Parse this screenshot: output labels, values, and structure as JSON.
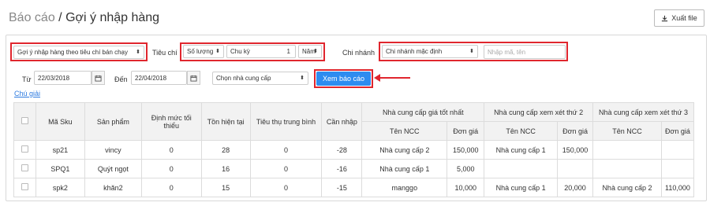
{
  "header": {
    "breadcrumb": "Báo cáo",
    "separator": " / ",
    "title": "Gợi ý nhập hàng",
    "export_label": "Xuất file"
  },
  "filters": {
    "mode_value": "Gợi ý nhập hàng theo tiêu chí bán chạy",
    "criteria_label": "Tiêu chí",
    "criteria_value": "Số lượng",
    "cycle_label": "Chu kỳ",
    "cycle_count": "1",
    "cycle_unit": "Năm",
    "branch_label": "Chi nhánh",
    "branch_value": "Chi nhánh mặc định",
    "search_placeholder": "Nhập mã, tên",
    "from_label": "Từ",
    "from_date": "22/03/2018",
    "to_label": "Đến",
    "to_date": "22/04/2018",
    "supplier_value": "Chọn nhà cung cấp",
    "report_button": "Xem báo cáo",
    "note_link": "Chú giải"
  },
  "table": {
    "headers": {
      "sku": "Mã Sku",
      "product": "Sản phẩm",
      "min_stock": "Định mức tối thiểu",
      "stock": "Tồn hiện tại",
      "avg_consumption": "Tiêu thụ trung bình",
      "need": "Cần nhập",
      "best_supplier": "Nhà cung cấp giá tốt nhất",
      "second_supplier": "Nhà cung cấp xem xét thứ 2",
      "third_supplier": "Nhà cung cấp xem xét thứ 3",
      "supplier_name": "Tên NCC",
      "unit_price": "Đơn giá"
    },
    "rows": [
      {
        "sku": "sp21",
        "product": "vincy",
        "min": "0",
        "stock": "28",
        "avg": "0",
        "need": "-28",
        "s1": "Nhà cung cấp 2",
        "p1": "150,000",
        "s2": "Nhà cung cấp 1",
        "p2": "150,000",
        "s3": "",
        "p3": ""
      },
      {
        "sku": "SPQ1",
        "product": "Quýt ngọt",
        "min": "0",
        "stock": "16",
        "avg": "0",
        "need": "-16",
        "s1": "Nhà cung cấp 1",
        "p1": "5,000",
        "s2": "",
        "p2": "",
        "s3": "",
        "p3": ""
      },
      {
        "sku": "spk2",
        "product": "khăn2",
        "min": "0",
        "stock": "15",
        "avg": "0",
        "need": "-15",
        "s1": "manggo",
        "p1": "10,000",
        "s2": "Nhà cung cấp 1",
        "p2": "20,000",
        "s3": "Nhà cung cấp 2",
        "p3": "110,000"
      }
    ]
  },
  "colors": {
    "accent_blue": "#2d8cf0",
    "highlight_red": "#e0262e"
  }
}
